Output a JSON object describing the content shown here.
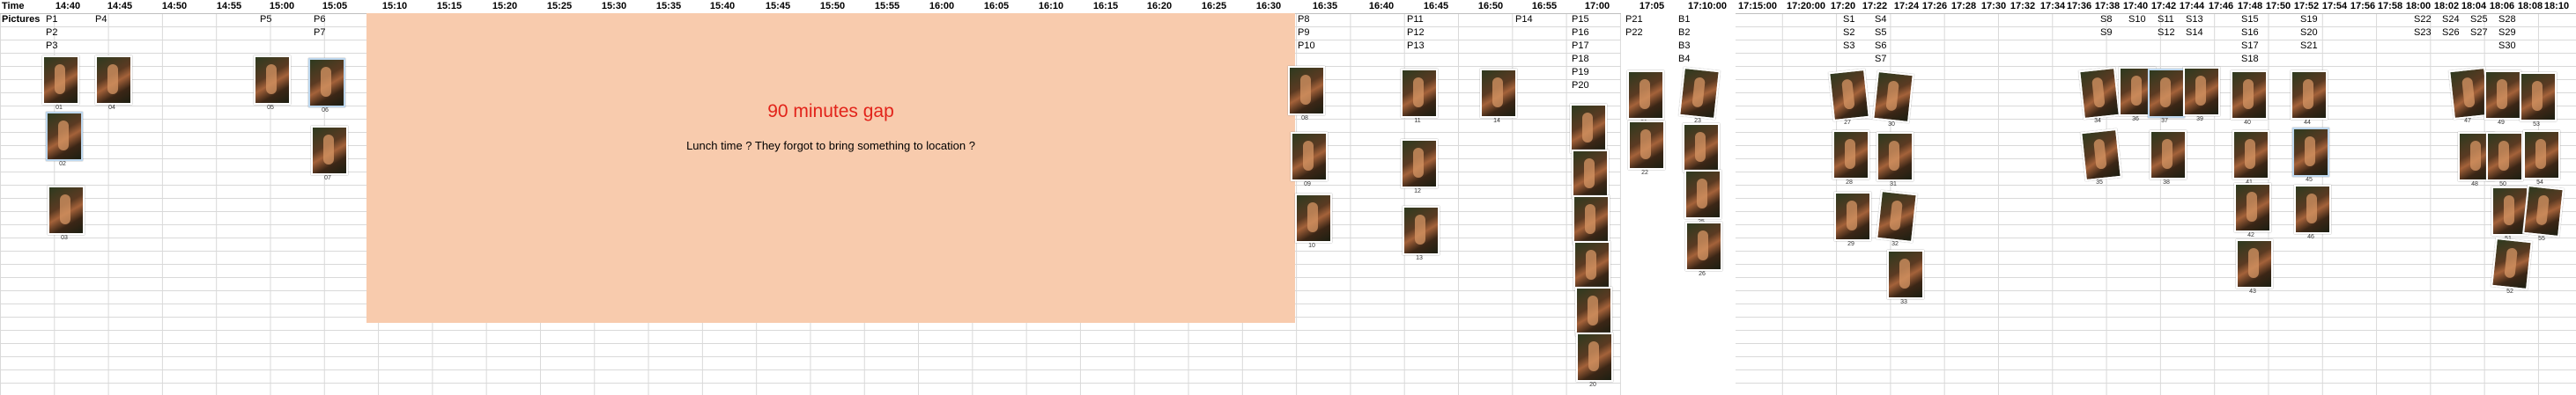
{
  "row_labels": {
    "time": "Time",
    "pictures": "Pictures"
  },
  "time_headers": [
    "14:40",
    "14:45",
    "14:50",
    "14:55",
    "15:00",
    "15:05",
    "15:10",
    "15:15",
    "15:20",
    "15:25",
    "15:30",
    "15:35",
    "15:40",
    "15:45",
    "15:50",
    "15:55",
    "16:00",
    "16:05",
    "16:10",
    "16:15",
    "16:20",
    "16:25",
    "16:30",
    "16:35",
    "16:40",
    "16:45",
    "16:50",
    "16:55",
    "17:00",
    "17:05",
    "17:10:00",
    "17:15:00",
    "17:20:00",
    "17:20",
    "17:22",
    "17:24",
    "17:26",
    "17:28",
    "17:30",
    "17:32",
    "17:34",
    "17:36",
    "17:38",
    "17:40",
    "17:42",
    "17:44",
    "17:46",
    "17:48",
    "17:50",
    "17:52",
    "17:54",
    "17:56",
    "17:58",
    "18:00",
    "18:02",
    "18:04",
    "18:06",
    "18:08",
    "18:10"
  ],
  "gap": {
    "title": "90 minutes gap",
    "note": "Lunch time ? They forgot to bring something to location ?"
  },
  "picture_labels": [
    [
      "P1",
      "P2",
      "P3"
    ],
    [
      "P4"
    ],
    [
      "P5"
    ],
    [
      "P6",
      "P7"
    ],
    [
      "P8",
      "P9",
      "P10"
    ],
    [
      "P11",
      "P12",
      "P13"
    ],
    [
      "P14"
    ],
    [
      "P15",
      "P16",
      "P17",
      "P18",
      "P19",
      "P20"
    ],
    [
      "P21",
      "P22"
    ],
    [
      "B1",
      "B2",
      "B3",
      "B4"
    ],
    [
      "S1",
      "S2",
      "S3"
    ],
    [
      "S4",
      "S5",
      "S6",
      "S7"
    ],
    [
      "S8",
      "S9"
    ],
    [
      "S10"
    ],
    [
      "S11",
      "S12"
    ],
    [
      "S13",
      "S14"
    ],
    [
      "S15",
      "S16",
      "S17",
      "S18"
    ],
    [
      "S19",
      "S20",
      "S21"
    ],
    [
      "S22",
      "S23"
    ],
    [
      "S24",
      "S26"
    ],
    [
      "S25",
      "S27"
    ],
    [
      "S28",
      "S29",
      "S30"
    ]
  ],
  "photo_captions": [
    "01",
    "02",
    "03",
    "04",
    "05",
    "06",
    "07",
    "08",
    "09",
    "10",
    "11",
    "12",
    "13",
    "14",
    "15",
    "16",
    "17",
    "18",
    "19",
    "20",
    "21",
    "22",
    "23",
    "24",
    "25",
    "26",
    "27",
    "28",
    "29",
    "30",
    "31",
    "32",
    "33",
    "34",
    "35",
    "36",
    "37",
    "38",
    "39",
    "40",
    "41",
    "42",
    "43",
    "44",
    "45",
    "46",
    "47",
    "48",
    "49",
    "50",
    "51",
    "52",
    "53",
    "54",
    "55",
    "56",
    "57",
    "58",
    "59",
    "60",
    "61",
    "62",
    "63",
    "64",
    "65",
    "66",
    "67",
    "68",
    "69",
    "70",
    "71",
    "72",
    "73",
    "74"
  ]
}
